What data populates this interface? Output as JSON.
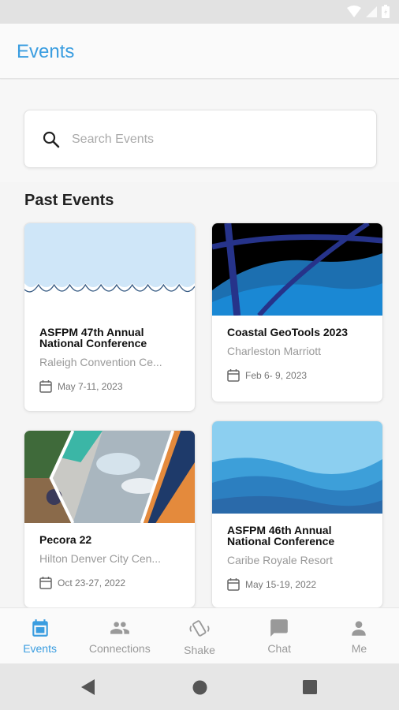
{
  "app": {
    "title": "Events"
  },
  "search": {
    "placeholder": "Search Events"
  },
  "section": {
    "title": "Past Events"
  },
  "events": [
    {
      "title": "ASFPM 47th Annual National Conference",
      "venue": "Raleigh Convention Ce...",
      "date": "May  7-11, 2023"
    },
    {
      "title": "Coastal GeoTools 2023",
      "venue": "Charleston Marriott",
      "date": "Feb  6- 9, 2023"
    },
    {
      "title": "Pecora 22",
      "venue": "Hilton Denver City Cen...",
      "date": "Oct 23-27, 2022"
    },
    {
      "title": "ASFPM 46th Annual National Conference",
      "venue": "Caribe Royale Resort",
      "date": "May 15-19, 2022"
    }
  ],
  "nav": {
    "items": [
      {
        "label": "Events",
        "icon": "calendar-icon",
        "active": true
      },
      {
        "label": "Connections",
        "icon": "people-icon",
        "active": false
      },
      {
        "label": "Shake",
        "icon": "shake-phone-icon",
        "active": false
      },
      {
        "label": "Chat",
        "icon": "chat-icon",
        "active": false
      },
      {
        "label": "Me",
        "icon": "person-icon",
        "active": false
      }
    ]
  },
  "colors": {
    "accent": "#3a9de0",
    "inactive": "#999999"
  }
}
